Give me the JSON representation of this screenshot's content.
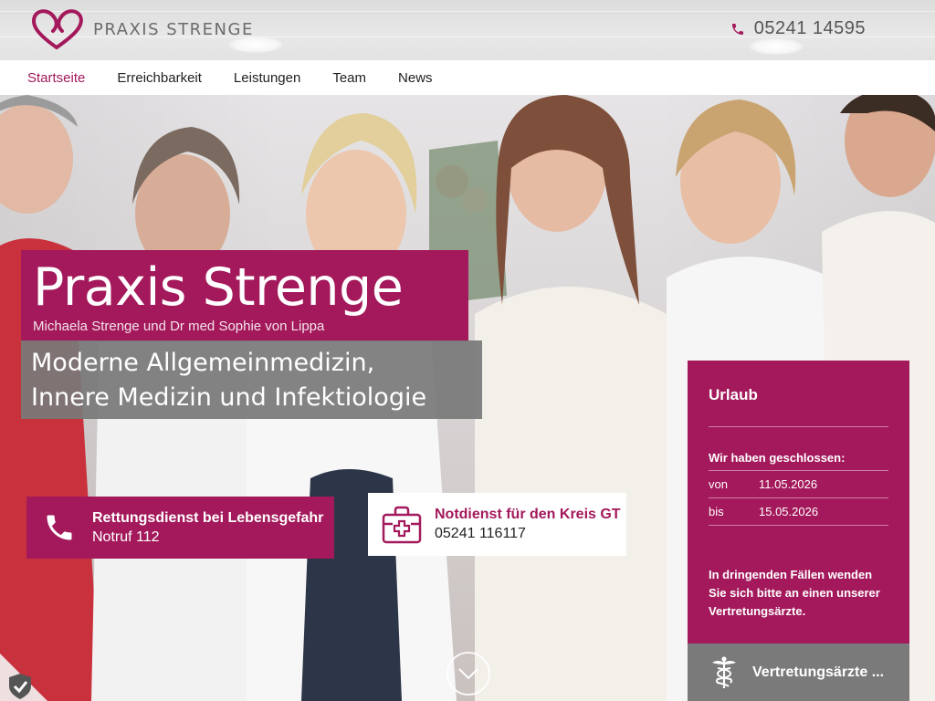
{
  "header": {
    "logo_text": "PRAXIS STRENGE",
    "phone": "05241 14595"
  },
  "nav": {
    "items": [
      {
        "label": "Startseite",
        "active": true
      },
      {
        "label": "Erreichbarkeit",
        "active": false
      },
      {
        "label": "Leistungen",
        "active": false
      },
      {
        "label": "Team",
        "active": false
      },
      {
        "label": "News",
        "active": false
      }
    ]
  },
  "hero": {
    "title": "Praxis Strenge",
    "subtitle": "Michaela Strenge und Dr med Sophie von Lippa",
    "tagline_1": "Moderne Allgemeinmedizin,",
    "tagline_2": "Innere Medizin und Infektiologie"
  },
  "emergency": {
    "rescue_title": "Rettungsdienst bei Lebensgefahr",
    "rescue_number": "Notruf 112",
    "notdienst_title": "Notdienst für den Kreis GT",
    "notdienst_number": "05241 116117"
  },
  "urlaub": {
    "heading": "Urlaub",
    "closed_label": "Wir haben geschlossen:",
    "from_label": "von",
    "from_date": "11.05.2026",
    "to_label": "bis",
    "to_date": "15.05.2026",
    "note": "In dringenden Fällen wenden Sie sich bitte an einen unserer Vertretungsärzte.",
    "link_label": "Vertretungsärzte ..."
  },
  "icons": {
    "logo": "heart-logo-icon",
    "phone": "phone-icon",
    "rescue": "phone-handset-icon",
    "notdienst": "medical-kit-icon",
    "vertretung": "caduceus-icon",
    "scroll": "chevron-down-icon",
    "privacy": "shield-check-icon"
  },
  "colors": {
    "brand": "#a3195b",
    "gray_panel": "#7a7a7a",
    "nav_active": "#a3195b"
  }
}
